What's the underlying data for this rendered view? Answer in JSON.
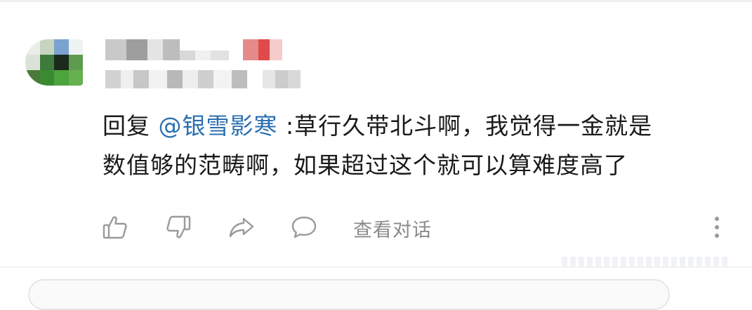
{
  "comment": {
    "reply_prefix": "回复 ",
    "mention": "@银雪影寒",
    "line1_rest": " :草行久带北斗啊，我觉得一金就是",
    "line2": "数值够的范畴啊，如果超过这个就可以算难度高了"
  },
  "actions": {
    "view_conversation": "查看对话",
    "icons": [
      "thumbs-up-icon",
      "thumbs-down-icon",
      "share-icon",
      "comment-icon",
      "more-icon"
    ]
  },
  "colors": {
    "mention": "#2a6fb0",
    "text": "#1a1a1a",
    "muted": "#8a8a8a",
    "icon": "#9a9a9a"
  }
}
